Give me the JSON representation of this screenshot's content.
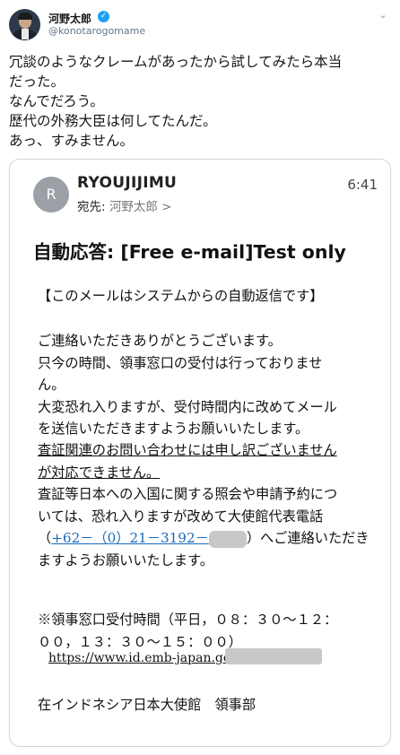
{
  "tweet": {
    "display_name": "河野太郎",
    "handle": "@konotarogomame",
    "lines": [
      "冗談のようなクレームがあったから試してみたら本当",
      "だった。",
      "なんでだろう。",
      "歴代の外務大臣は何してたんだ。",
      "あっ、すみません。"
    ]
  },
  "email": {
    "avatar_letter": "R",
    "sender": "RYOUJIJIMU",
    "time": "6:41",
    "to_label": "宛先:",
    "to_name": "河野太郎",
    "to_chevron": ">",
    "subject": "自動応答: [Free e-mail]Test only",
    "auto_notice": "【このメールはシステムからの自動返信です】",
    "p1": [
      "ご連絡いただきありがとうございます。",
      "只今の時間、領事窓口の受付は行っておりませ",
      "ん。",
      "大変恐れ入りますが、受付時間内に改めてメール",
      "を送信いただきますようお願いいたします。"
    ],
    "p2_underlined": [
      "査証関連のお問い合わせには申し訳ございません",
      "が対応できません。"
    ],
    "p3": [
      "査証等日本への入国に関する照会や申請予約につ",
      "いては、恐れ入りますが改めて大使館代表電話"
    ],
    "phone_open": "（",
    "phone": "+62－（0）21－3192－",
    "phone_after": "）へご連絡いただき",
    "p3_last": "ますようお願いいたします。",
    "hours": [
      "※領事窓口受付時間（平日，０８：３０～１２：",
      "００，１３：３０～１５：００）"
    ],
    "url": "https://www.id.emb-japan.go.",
    "signature": "在インドネシア日本大使館　領事部"
  },
  "icons": {
    "verified": "verified-badge-icon",
    "caret": "chevron-down-icon"
  },
  "colors": {
    "verified_blue": "#1da1f2",
    "link_blue": "#1a6bbf",
    "redaction_gray": "#c8c8c8"
  }
}
